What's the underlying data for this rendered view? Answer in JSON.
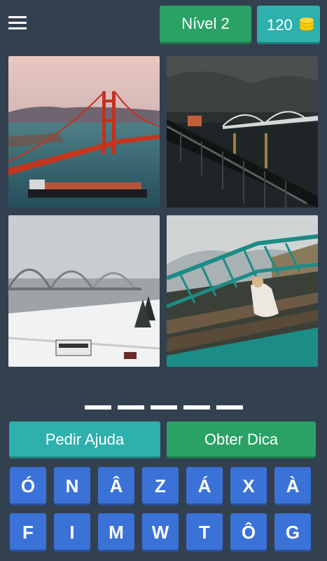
{
  "header": {
    "level_label": "Nível 2",
    "coins": "120",
    "coin_icon": "coins-icon",
    "menu_icon": "hamburger-menu-icon"
  },
  "photos": [
    {
      "subject": "Red suspension bridge over bay with cargo ship"
    },
    {
      "subject": "Lit bridge at night over river with railing and stormy sky"
    },
    {
      "subject": "Arch bridges in foggy winter with snowy road and bus"
    },
    {
      "subject": "Woman sitting on green steel railway bridge tracks"
    }
  ],
  "answer": {
    "letter_count": 5
  },
  "actions": {
    "help_label": "Pedir Ajuda",
    "hint_label": "Obter Dica"
  },
  "keyboard": {
    "row1": [
      "Ó",
      "N",
      "Â",
      "Z",
      "Á",
      "X",
      "À"
    ],
    "row2": [
      "F",
      "I",
      "M",
      "W",
      "T",
      "Ô",
      "G"
    ]
  },
  "colors": {
    "background": "#33404f",
    "green": "#2aa265",
    "teal": "#2eb0ac",
    "key_blue": "#3a72d8"
  }
}
